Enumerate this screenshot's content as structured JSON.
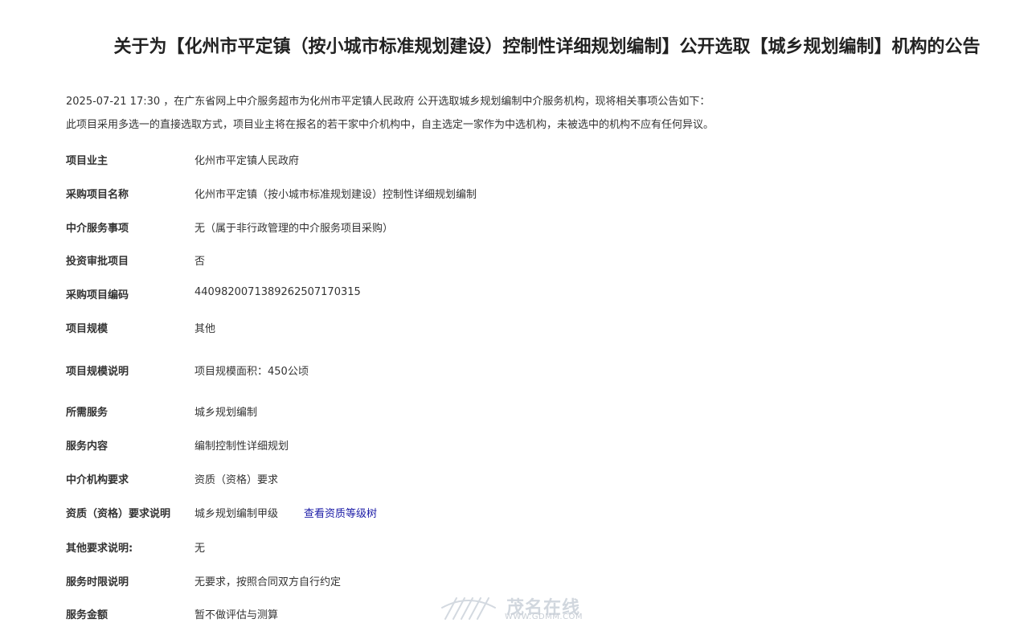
{
  "announcement": {
    "title": "关于为【化州市平定镇（按小城市标准规划建设）控制性详细规划编制】公开选取【城乡规划编制】机构的公告",
    "intro_line1": "2025-07-21 17:30 ，在广东省网上中介服务超市为化州市平定镇人民政府 公开选取城乡规划编制中介服务机构，现将相关事项公告如下：",
    "intro_line2": "此项目采用多选一的直接选取方式，项目业主将在报名的若干家中介机构中，自主选定一家作为中选机构，未被选中的机构不应有任何异议。"
  },
  "details": [
    {
      "label": "项目业主",
      "value": "化州市平定镇人民政府"
    },
    {
      "label": "采购项目名称",
      "value": "化州市平定镇（按小城市标准规划建设）控制性详细规划编制"
    },
    {
      "label": "中介服务事项",
      "value": "无（属于非行政管理的中介服务项目采购）"
    },
    {
      "label": "投资审批项目",
      "value": "否"
    },
    {
      "label": "采购项目编码",
      "value": "440982007138926250717031​5"
    },
    {
      "label": "项目规模",
      "value": "其他"
    },
    {
      "label": "项目规模说明",
      "value": "项目规模面积：450公顷"
    },
    {
      "label": "所需服务",
      "value": "城乡规划编制"
    },
    {
      "label": "服务内容",
      "value": "编制控制性详细规划"
    },
    {
      "label": "中介机构要求",
      "value": "资质（资格）要求"
    },
    {
      "label": "资质（资格）要求说明",
      "value": "城乡规划编制甲级",
      "link": "查看资质等级树"
    },
    {
      "label": "其他要求说明:",
      "value": "无"
    },
    {
      "label": "服务时限说明",
      "value": "无要求，按照合同双方自行约定"
    },
    {
      "label": "服务金额",
      "value": "暂不做评估与测算"
    }
  ],
  "watermark": {
    "text": "茂名在线",
    "url": "WWW.GDMM.COM"
  }
}
